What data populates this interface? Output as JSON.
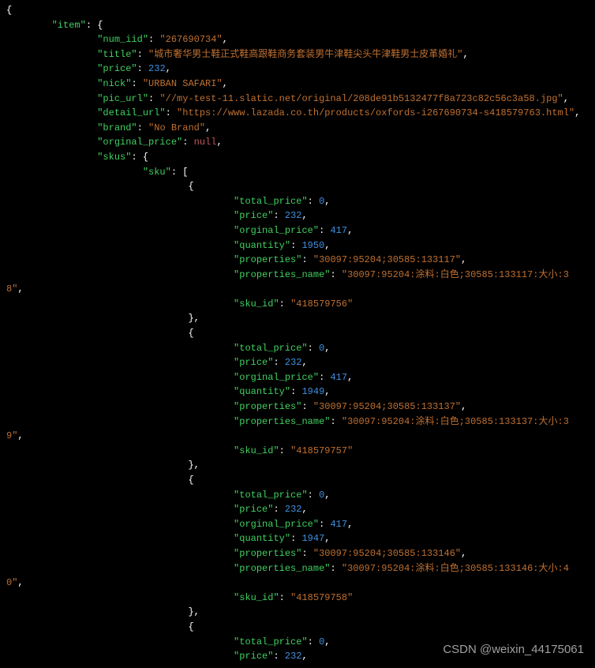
{
  "watermark": "CSDN @weixin_44175061",
  "json_lines": [
    {
      "indent": 0,
      "tokens": [
        {
          "t": "brace",
          "v": "{"
        }
      ]
    },
    {
      "indent": 8,
      "tokens": [
        {
          "t": "key",
          "v": "\"item\""
        },
        {
          "t": "colon",
          "v": ": "
        },
        {
          "t": "brace",
          "v": "{"
        }
      ]
    },
    {
      "indent": 16,
      "tokens": [
        {
          "t": "key",
          "v": "\"num_iid\""
        },
        {
          "t": "colon",
          "v": ": "
        },
        {
          "t": "str",
          "v": "\"267690734\""
        },
        {
          "t": "comma",
          "v": ","
        }
      ]
    },
    {
      "indent": 16,
      "tokens": [
        {
          "t": "key",
          "v": "\"title\""
        },
        {
          "t": "colon",
          "v": ": "
        },
        {
          "t": "str",
          "v": "\"城市奢华男士鞋正式鞋高跟鞋商务套装男牛津鞋尖头牛津鞋男士皮革婚礼\""
        },
        {
          "t": "comma",
          "v": ","
        }
      ]
    },
    {
      "indent": 16,
      "tokens": [
        {
          "t": "key",
          "v": "\"price\""
        },
        {
          "t": "colon",
          "v": ": "
        },
        {
          "t": "num",
          "v": "232"
        },
        {
          "t": "comma",
          "v": ","
        }
      ]
    },
    {
      "indent": 16,
      "tokens": [
        {
          "t": "key",
          "v": "\"nick\""
        },
        {
          "t": "colon",
          "v": ": "
        },
        {
          "t": "str",
          "v": "\"URBAN SAFARI\""
        },
        {
          "t": "comma",
          "v": ","
        }
      ]
    },
    {
      "indent": 16,
      "tokens": [
        {
          "t": "key",
          "v": "\"pic_url\""
        },
        {
          "t": "colon",
          "v": ": "
        },
        {
          "t": "str",
          "v": "\"//my-test-11.slatic.net/original/208de91b5132477f8a723c82c56c3a58.jpg\""
        },
        {
          "t": "comma",
          "v": ","
        }
      ]
    },
    {
      "indent": 16,
      "tokens": [
        {
          "t": "key",
          "v": "\"detail_url\""
        },
        {
          "t": "colon",
          "v": ": "
        },
        {
          "t": "str",
          "v": "\"https://www.lazada.co.th/products/oxfords-i267690734-s418579763.html\""
        },
        {
          "t": "comma",
          "v": ","
        }
      ]
    },
    {
      "indent": 16,
      "tokens": [
        {
          "t": "key",
          "v": "\"brand\""
        },
        {
          "t": "colon",
          "v": ": "
        },
        {
          "t": "str",
          "v": "\"No Brand\""
        },
        {
          "t": "comma",
          "v": ","
        }
      ]
    },
    {
      "indent": 16,
      "tokens": [
        {
          "t": "key",
          "v": "\"orginal_price\""
        },
        {
          "t": "colon",
          "v": ": "
        },
        {
          "t": "null",
          "v": "null"
        },
        {
          "t": "comma",
          "v": ","
        }
      ]
    },
    {
      "indent": 16,
      "tokens": [
        {
          "t": "key",
          "v": "\"skus\""
        },
        {
          "t": "colon",
          "v": ": "
        },
        {
          "t": "brace",
          "v": "{"
        }
      ]
    },
    {
      "indent": 24,
      "tokens": [
        {
          "t": "key",
          "v": "\"sku\""
        },
        {
          "t": "colon",
          "v": ": "
        },
        {
          "t": "bracket",
          "v": "["
        }
      ]
    },
    {
      "indent": 32,
      "tokens": [
        {
          "t": "brace",
          "v": "{"
        }
      ]
    },
    {
      "indent": 40,
      "tokens": [
        {
          "t": "key",
          "v": "\"total_price\""
        },
        {
          "t": "colon",
          "v": ": "
        },
        {
          "t": "num",
          "v": "0"
        },
        {
          "t": "comma",
          "v": ","
        }
      ]
    },
    {
      "indent": 40,
      "tokens": [
        {
          "t": "key",
          "v": "\"price\""
        },
        {
          "t": "colon",
          "v": ": "
        },
        {
          "t": "num",
          "v": "232"
        },
        {
          "t": "comma",
          "v": ","
        }
      ]
    },
    {
      "indent": 40,
      "tokens": [
        {
          "t": "key",
          "v": "\"orginal_price\""
        },
        {
          "t": "colon",
          "v": ": "
        },
        {
          "t": "num",
          "v": "417"
        },
        {
          "t": "comma",
          "v": ","
        }
      ]
    },
    {
      "indent": 40,
      "tokens": [
        {
          "t": "key",
          "v": "\"quantity\""
        },
        {
          "t": "colon",
          "v": ": "
        },
        {
          "t": "num",
          "v": "1950"
        },
        {
          "t": "comma",
          "v": ","
        }
      ]
    },
    {
      "indent": 40,
      "tokens": [
        {
          "t": "key",
          "v": "\"properties\""
        },
        {
          "t": "colon",
          "v": ": "
        },
        {
          "t": "str",
          "v": "\"30097:95204;30585:133117\""
        },
        {
          "t": "comma",
          "v": ","
        }
      ]
    },
    {
      "indent": 40,
      "wrapStart": true,
      "tokens": [
        {
          "t": "key",
          "v": "\"properties_name\""
        },
        {
          "t": "colon",
          "v": ": "
        },
        {
          "t": "str",
          "v": "\"30097:95204:涂料:白色;30585:133117:大小:3"
        }
      ]
    },
    {
      "indent": 0,
      "wrapEnd": true,
      "tokens": [
        {
          "t": "str",
          "v": "8\""
        },
        {
          "t": "comma",
          "v": ","
        }
      ]
    },
    {
      "indent": 40,
      "tokens": [
        {
          "t": "key",
          "v": "\"sku_id\""
        },
        {
          "t": "colon",
          "v": ": "
        },
        {
          "t": "str",
          "v": "\"418579756\""
        }
      ]
    },
    {
      "indent": 32,
      "tokens": [
        {
          "t": "brace",
          "v": "}"
        },
        {
          "t": "comma",
          "v": ","
        }
      ]
    },
    {
      "indent": 32,
      "tokens": [
        {
          "t": "brace",
          "v": "{"
        }
      ]
    },
    {
      "indent": 40,
      "tokens": [
        {
          "t": "key",
          "v": "\"total_price\""
        },
        {
          "t": "colon",
          "v": ": "
        },
        {
          "t": "num",
          "v": "0"
        },
        {
          "t": "comma",
          "v": ","
        }
      ]
    },
    {
      "indent": 40,
      "tokens": [
        {
          "t": "key",
          "v": "\"price\""
        },
        {
          "t": "colon",
          "v": ": "
        },
        {
          "t": "num",
          "v": "232"
        },
        {
          "t": "comma",
          "v": ","
        }
      ]
    },
    {
      "indent": 40,
      "tokens": [
        {
          "t": "key",
          "v": "\"orginal_price\""
        },
        {
          "t": "colon",
          "v": ": "
        },
        {
          "t": "num",
          "v": "417"
        },
        {
          "t": "comma",
          "v": ","
        }
      ]
    },
    {
      "indent": 40,
      "tokens": [
        {
          "t": "key",
          "v": "\"quantity\""
        },
        {
          "t": "colon",
          "v": ": "
        },
        {
          "t": "num",
          "v": "1949"
        },
        {
          "t": "comma",
          "v": ","
        }
      ]
    },
    {
      "indent": 40,
      "tokens": [
        {
          "t": "key",
          "v": "\"properties\""
        },
        {
          "t": "colon",
          "v": ": "
        },
        {
          "t": "str",
          "v": "\"30097:95204;30585:133137\""
        },
        {
          "t": "comma",
          "v": ","
        }
      ]
    },
    {
      "indent": 40,
      "wrapStart": true,
      "tokens": [
        {
          "t": "key",
          "v": "\"properties_name\""
        },
        {
          "t": "colon",
          "v": ": "
        },
        {
          "t": "str",
          "v": "\"30097:95204:涂料:白色;30585:133137:大小:3"
        }
      ]
    },
    {
      "indent": 0,
      "wrapEnd": true,
      "tokens": [
        {
          "t": "str",
          "v": "9\""
        },
        {
          "t": "comma",
          "v": ","
        }
      ]
    },
    {
      "indent": 40,
      "tokens": [
        {
          "t": "key",
          "v": "\"sku_id\""
        },
        {
          "t": "colon",
          "v": ": "
        },
        {
          "t": "str",
          "v": "\"418579757\""
        }
      ]
    },
    {
      "indent": 32,
      "tokens": [
        {
          "t": "brace",
          "v": "}"
        },
        {
          "t": "comma",
          "v": ","
        }
      ]
    },
    {
      "indent": 32,
      "tokens": [
        {
          "t": "brace",
          "v": "{"
        }
      ]
    },
    {
      "indent": 40,
      "tokens": [
        {
          "t": "key",
          "v": "\"total_price\""
        },
        {
          "t": "colon",
          "v": ": "
        },
        {
          "t": "num",
          "v": "0"
        },
        {
          "t": "comma",
          "v": ","
        }
      ]
    },
    {
      "indent": 40,
      "tokens": [
        {
          "t": "key",
          "v": "\"price\""
        },
        {
          "t": "colon",
          "v": ": "
        },
        {
          "t": "num",
          "v": "232"
        },
        {
          "t": "comma",
          "v": ","
        }
      ]
    },
    {
      "indent": 40,
      "tokens": [
        {
          "t": "key",
          "v": "\"orginal_price\""
        },
        {
          "t": "colon",
          "v": ": "
        },
        {
          "t": "num",
          "v": "417"
        },
        {
          "t": "comma",
          "v": ","
        }
      ]
    },
    {
      "indent": 40,
      "tokens": [
        {
          "t": "key",
          "v": "\"quantity\""
        },
        {
          "t": "colon",
          "v": ": "
        },
        {
          "t": "num",
          "v": "1947"
        },
        {
          "t": "comma",
          "v": ","
        }
      ]
    },
    {
      "indent": 40,
      "tokens": [
        {
          "t": "key",
          "v": "\"properties\""
        },
        {
          "t": "colon",
          "v": ": "
        },
        {
          "t": "str",
          "v": "\"30097:95204;30585:133146\""
        },
        {
          "t": "comma",
          "v": ","
        }
      ]
    },
    {
      "indent": 40,
      "wrapStart": true,
      "tokens": [
        {
          "t": "key",
          "v": "\"properties_name\""
        },
        {
          "t": "colon",
          "v": ": "
        },
        {
          "t": "str",
          "v": "\"30097:95204:涂料:白色;30585:133146:大小:4"
        }
      ]
    },
    {
      "indent": 0,
      "wrapEnd": true,
      "tokens": [
        {
          "t": "str",
          "v": "0\""
        },
        {
          "t": "comma",
          "v": ","
        }
      ]
    },
    {
      "indent": 40,
      "tokens": [
        {
          "t": "key",
          "v": "\"sku_id\""
        },
        {
          "t": "colon",
          "v": ": "
        },
        {
          "t": "str",
          "v": "\"418579758\""
        }
      ]
    },
    {
      "indent": 32,
      "tokens": [
        {
          "t": "brace",
          "v": "}"
        },
        {
          "t": "comma",
          "v": ","
        }
      ]
    },
    {
      "indent": 32,
      "tokens": [
        {
          "t": "brace",
          "v": "{"
        }
      ]
    },
    {
      "indent": 40,
      "tokens": [
        {
          "t": "key",
          "v": "\"total_price\""
        },
        {
          "t": "colon",
          "v": ": "
        },
        {
          "t": "num",
          "v": "0"
        },
        {
          "t": "comma",
          "v": ","
        }
      ]
    },
    {
      "indent": 40,
      "tokens": [
        {
          "t": "key",
          "v": "\"price\""
        },
        {
          "t": "colon",
          "v": ": "
        },
        {
          "t": "num",
          "v": "232"
        },
        {
          "t": "comma",
          "v": ","
        }
      ]
    }
  ]
}
